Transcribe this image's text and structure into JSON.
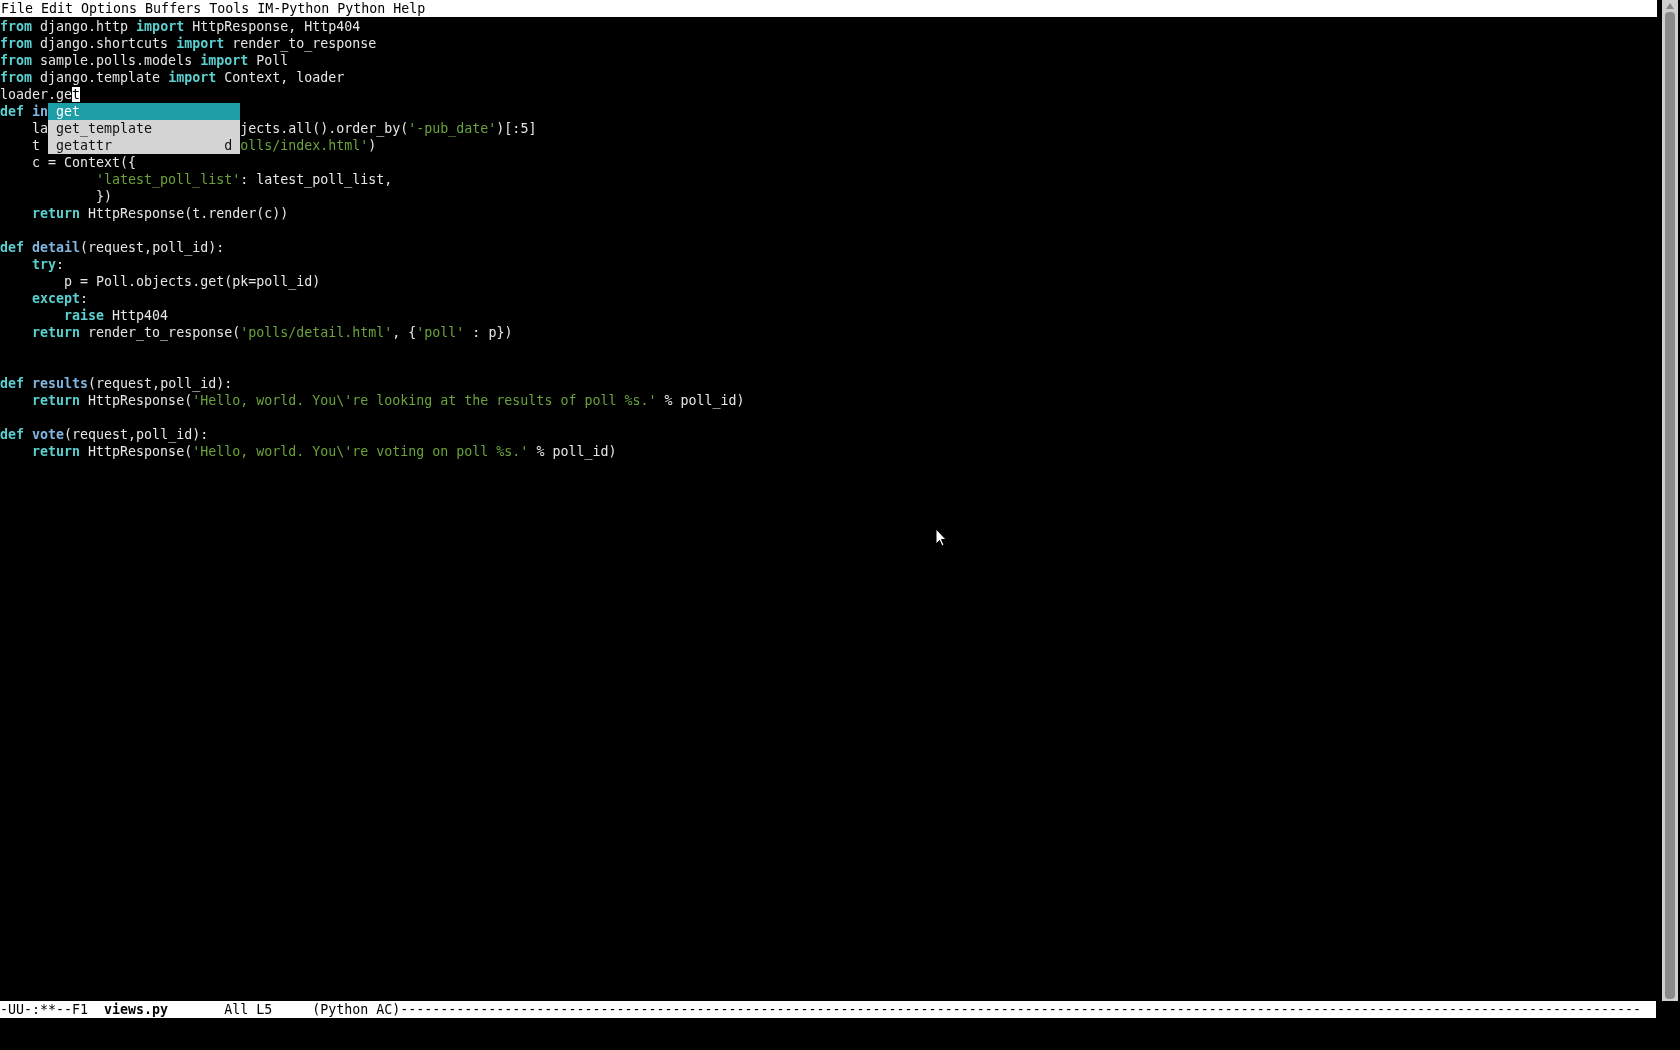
{
  "menu_bar": [
    "File",
    "Edit",
    "Options",
    "Buffers",
    "Tools",
    "IM-Python",
    "Python",
    "Help"
  ],
  "lines": [
    {
      "kind": "code",
      "segments": [
        {
          "kind": "keyword",
          "text": "from"
        },
        {
          "kind": "plain",
          "text": " django.http "
        },
        {
          "kind": "keyword",
          "text": "import"
        },
        {
          "kind": "plain",
          "text": " HttpResponse, Http404"
        }
      ]
    },
    {
      "kind": "code",
      "segments": [
        {
          "kind": "keyword",
          "text": "from"
        },
        {
          "kind": "plain",
          "text": " django.shortcuts "
        },
        {
          "kind": "keyword",
          "text": "import"
        },
        {
          "kind": "plain",
          "text": " render_to_response"
        }
      ]
    },
    {
      "kind": "code",
      "segments": [
        {
          "kind": "keyword",
          "text": "from"
        },
        {
          "kind": "plain",
          "text": " sample.polls.models "
        },
        {
          "kind": "keyword",
          "text": "import"
        },
        {
          "kind": "plain",
          "text": " Poll"
        }
      ]
    },
    {
      "kind": "code",
      "segments": [
        {
          "kind": "keyword",
          "text": "from"
        },
        {
          "kind": "plain",
          "text": " django.template "
        },
        {
          "kind": "keyword",
          "text": "import"
        },
        {
          "kind": "plain",
          "text": " Context, loader"
        }
      ]
    },
    {
      "kind": "code",
      "segments": [
        {
          "kind": "plain",
          "text": "loader.ge"
        },
        {
          "kind": "cursor",
          "text": "t"
        }
      ]
    },
    {
      "kind": "code",
      "segments": [
        {
          "kind": "keyword",
          "text": "def"
        },
        {
          "kind": "function",
          "text": " in"
        }
      ],
      "completion": {
        "label": "get",
        "selected": true
      }
    },
    {
      "kind": "code",
      "segments": [
        {
          "kind": "plain",
          "text": "    la"
        }
      ],
      "completion": {
        "label": "get_template",
        "selected": false
      },
      "after": [
        {
          "kind": "plain",
          "text": "jects.all().order_by("
        },
        {
          "kind": "string",
          "text": "'-pub_date'"
        },
        {
          "kind": "plain",
          "text": ")[:5]"
        }
      ]
    },
    {
      "kind": "code",
      "segments": [
        {
          "kind": "plain",
          "text": "    t "
        }
      ],
      "completion": {
        "label": "getattr",
        "annotation": "d",
        "selected": false
      },
      "after": [
        {
          "kind": "string",
          "text": "olls/index.html'"
        },
        {
          "kind": "plain",
          "text": ")"
        }
      ]
    },
    {
      "kind": "code",
      "segments": [
        {
          "kind": "plain",
          "text": "    c = Context({"
        }
      ]
    },
    {
      "kind": "code",
      "segments": [
        {
          "kind": "string",
          "text": "            'latest_poll_list'"
        },
        {
          "kind": "plain",
          "text": ": latest_poll_list,"
        }
      ]
    },
    {
      "kind": "code",
      "segments": [
        {
          "kind": "plain",
          "text": "            })"
        }
      ]
    },
    {
      "kind": "code",
      "segments": [
        {
          "kind": "keyword",
          "text": "    return"
        },
        {
          "kind": "plain",
          "text": " HttpResponse(t.render(c))"
        }
      ]
    },
    {
      "kind": "blank"
    },
    {
      "kind": "code",
      "segments": [
        {
          "kind": "keyword",
          "text": "def"
        },
        {
          "kind": "function",
          "text": " detail"
        },
        {
          "kind": "plain",
          "text": "(request,poll_id):"
        }
      ]
    },
    {
      "kind": "code",
      "segments": [
        {
          "kind": "keyword",
          "text": "    try"
        },
        {
          "kind": "plain",
          "text": ":"
        }
      ]
    },
    {
      "kind": "code",
      "segments": [
        {
          "kind": "plain",
          "text": "        p = Poll.objects.get(pk=poll_id)"
        }
      ]
    },
    {
      "kind": "code",
      "segments": [
        {
          "kind": "keyword",
          "text": "    except"
        },
        {
          "kind": "plain",
          "text": ":"
        }
      ]
    },
    {
      "kind": "code",
      "segments": [
        {
          "kind": "keyword",
          "text": "        raise"
        },
        {
          "kind": "plain",
          "text": " Http404"
        }
      ]
    },
    {
      "kind": "code",
      "segments": [
        {
          "kind": "keyword",
          "text": "    return"
        },
        {
          "kind": "plain",
          "text": " render_to_response("
        },
        {
          "kind": "string",
          "text": "'polls/detail.html'"
        },
        {
          "kind": "plain",
          "text": ", {"
        },
        {
          "kind": "string",
          "text": "'poll'"
        },
        {
          "kind": "plain",
          "text": " : p})"
        }
      ]
    },
    {
      "kind": "blank"
    },
    {
      "kind": "blank"
    },
    {
      "kind": "code",
      "segments": [
        {
          "kind": "keyword",
          "text": "def"
        },
        {
          "kind": "function",
          "text": " results"
        },
        {
          "kind": "plain",
          "text": "(request,poll_id):"
        }
      ]
    },
    {
      "kind": "code",
      "segments": [
        {
          "kind": "keyword",
          "text": "    return"
        },
        {
          "kind": "plain",
          "text": " HttpResponse("
        },
        {
          "kind": "string",
          "text": "'Hello, world. You\\'re looking at the results of poll %s.'"
        },
        {
          "kind": "plain",
          "text": " % poll_id)"
        }
      ]
    },
    {
      "kind": "blank"
    },
    {
      "kind": "code",
      "segments": [
        {
          "kind": "keyword",
          "text": "def"
        },
        {
          "kind": "function",
          "text": " vote"
        },
        {
          "kind": "plain",
          "text": "(request,poll_id):"
        }
      ]
    },
    {
      "kind": "code",
      "segments": [
        {
          "kind": "keyword",
          "text": "    return"
        },
        {
          "kind": "plain",
          "text": " HttpResponse("
        },
        {
          "kind": "string",
          "text": "'Hello, world. You\\'re voting on poll %s.'"
        },
        {
          "kind": "plain",
          "text": " % poll_id)"
        }
      ]
    }
  ],
  "mode_line": {
    "status": "-UU-:**--F1",
    "buffer": "views.py",
    "position": "All L5",
    "mode": "(Python AC)",
    "fill": "-----------------------------------------------------------------------------------------------------------------------------------------------------------"
  }
}
